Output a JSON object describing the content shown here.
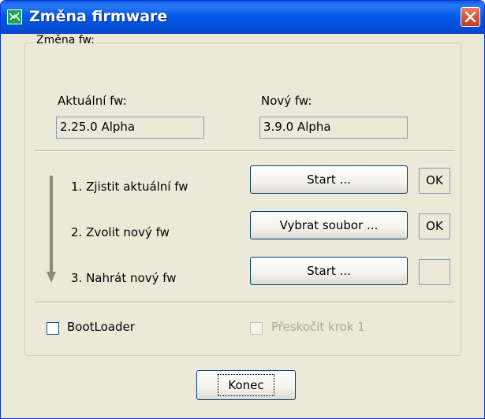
{
  "window": {
    "title": "Změna firmware"
  },
  "group": {
    "legend": "Změna fw:",
    "current_label": "Aktuální fw:",
    "current_value": "2.25.0 Alpha",
    "new_label": "Nový fw:",
    "new_value": "3.9.0 Alpha"
  },
  "steps": [
    {
      "label": "1. Zjistit aktuální fw",
      "button": "Start ...",
      "status": "OK"
    },
    {
      "label": "2. Zvolit nový fw",
      "button": "Vybrat soubor ...",
      "status": "OK"
    },
    {
      "label": "3. Nahrát nový fw",
      "button": "Start ...",
      "status": ""
    }
  ],
  "options": {
    "bootloader_label": "BootLoader",
    "bootloader_checked": false,
    "skip_step_label": "Přeskočit krok 1",
    "skip_step_checked": false,
    "skip_step_enabled": false
  },
  "footer": {
    "close_label": "Konec"
  },
  "icons": {
    "app": "app-icon",
    "close": "close-icon",
    "steps_arrow": "arrow-down-icon"
  }
}
